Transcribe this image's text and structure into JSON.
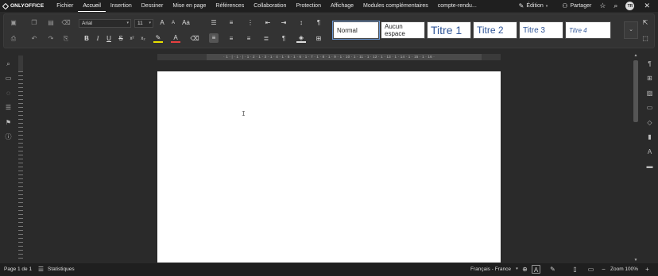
{
  "app": {
    "logo_text": "ONLYOFFICE",
    "accent": "#6b9ad8"
  },
  "menu": {
    "items": [
      "Fichier",
      "Accueil",
      "Insertion",
      "Dessiner",
      "Mise en page",
      "Références",
      "Collaboration",
      "Protection",
      "Affichage",
      "Modules complémentaires"
    ],
    "active": "Accueil",
    "document_title": "compte-rendu...",
    "mode_label": "Édition",
    "share_label": "Partager",
    "avatar_initials": "TR"
  },
  "toolbar": {
    "font_name": "Arial",
    "font_size": "11",
    "styles": [
      "Normal",
      "Aucun espace",
      "Titre 1",
      "Titre 2",
      "Titre 3",
      "Titre 4"
    ],
    "selected_style": "Normal"
  },
  "ruler": {
    "numbers": "· 1 · | · 1 · | · 1 · 2 · 1 · 3 · 1 · 4 · 1 · 5 · 1 · 6 · 1 · 7 · 1 · 8 · 1 · 9 · 1 · 10 · 1 · 11 · 1 · 12 · 1 · 13 · 1 · 14 · 1 · 15 · 1 · 16 ·"
  },
  "statusbar": {
    "page_info": "Page 1 de 1",
    "statistics": "Statistiques",
    "language": "Français - France",
    "zoom": "Zoom 100%"
  }
}
